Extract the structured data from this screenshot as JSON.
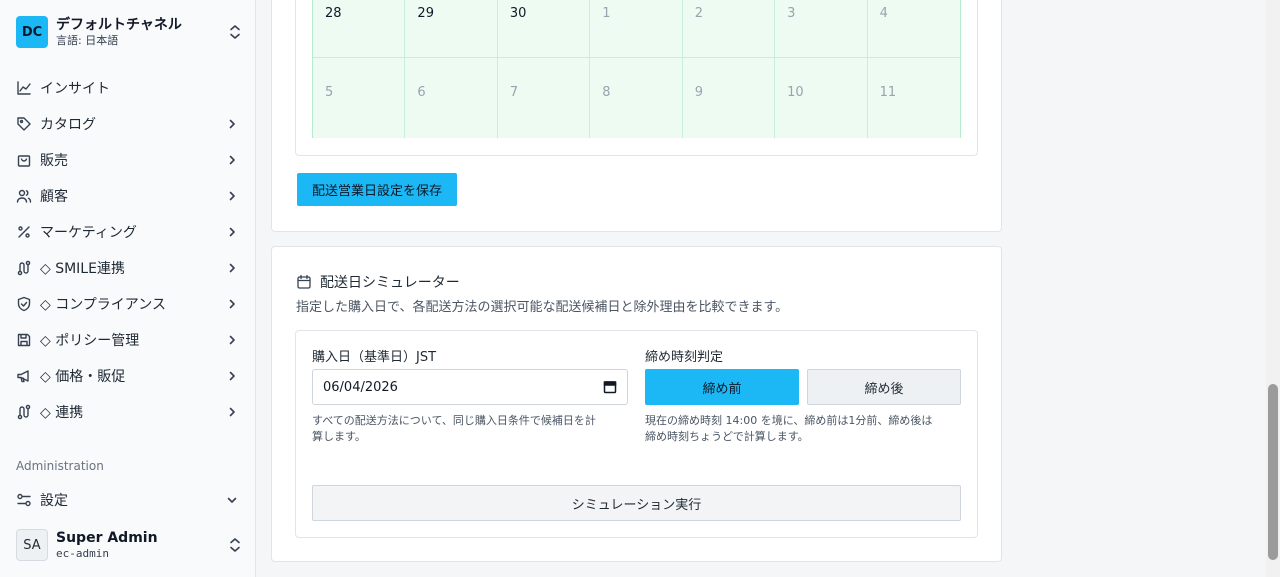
{
  "sidebar": {
    "channel": {
      "badge": "DC",
      "name": "デフォルトチャネル",
      "language": "言語: 日本語"
    },
    "items": [
      {
        "label": "インサイト",
        "icon": "chart-line-icon"
      },
      {
        "label": "カタログ",
        "icon": "tag-icon"
      },
      {
        "label": "販売",
        "icon": "shopping-bag-icon"
      },
      {
        "label": "顧客",
        "icon": "users-icon"
      },
      {
        "label": "マーケティング",
        "icon": "percent-icon"
      },
      {
        "label": "◇ SMILE連携",
        "icon": "route-icon"
      },
      {
        "label": "◇ コンプライアンス",
        "icon": "shield-check-icon"
      },
      {
        "label": "◇ ポリシー管理",
        "icon": "save-icon"
      },
      {
        "label": "◇ 価格・販促",
        "icon": "megaphone-icon"
      },
      {
        "label": "◇ 連携",
        "icon": "route-icon"
      }
    ],
    "admin_section": "Administration",
    "settings_label": "設定",
    "user": {
      "initials": "SA",
      "name": "Super Admin",
      "username": "ec-admin"
    }
  },
  "calendar": {
    "rows": [
      [
        {
          "d": "28",
          "cur": true
        },
        {
          "d": "29",
          "cur": true
        },
        {
          "d": "30",
          "cur": true
        },
        {
          "d": "1",
          "cur": false
        },
        {
          "d": "2",
          "cur": false
        },
        {
          "d": "3",
          "cur": false
        },
        {
          "d": "4",
          "cur": false
        }
      ],
      [
        {
          "d": "5",
          "cur": false
        },
        {
          "d": "6",
          "cur": false
        },
        {
          "d": "7",
          "cur": false
        },
        {
          "d": "8",
          "cur": false
        },
        {
          "d": "9",
          "cur": false
        },
        {
          "d": "10",
          "cur": false
        },
        {
          "d": "11",
          "cur": false
        }
      ]
    ]
  },
  "save_button": "配送営業日設定を保存",
  "simulator": {
    "title": "配送日シミュレーター",
    "description": "指定した購入日で、各配送方法の選択可能な配送候補日と除外理由を比較できます。",
    "purchase_label": "購入日（基準日）JST",
    "purchase_value": "06/04/2026",
    "purchase_help_1": "すべての配送方法について、同じ購入日条件で候補日を計",
    "purchase_help_2": "算します。",
    "cutoff_label": "締め時刻判定",
    "cutoff_before": "締め前",
    "cutoff_after": "締め後",
    "cutoff_selected": "締め前",
    "cutoff_help_1": "現在の締め時刻 14:00 を境に、締め前は1分前、締め後は",
    "cutoff_help_2": "締め時刻ちょうどで計算します。",
    "run_button": "シミュレーション実行"
  },
  "colors": {
    "accent": "#1cb8f5",
    "calendar_bg": "#edfbf3",
    "calendar_border": "#c9eed8"
  }
}
